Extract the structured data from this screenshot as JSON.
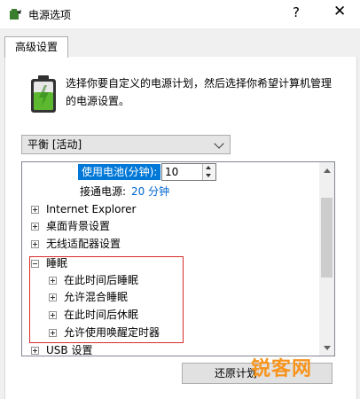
{
  "window": {
    "title": "电源选项",
    "help_label": "?",
    "close_label": "✕",
    "icon": "power-options-app-icon"
  },
  "tabs": [
    {
      "label": "高级设置",
      "active": true
    }
  ],
  "intro": {
    "icon": "battery-icon",
    "text": "选择你要自定义的电源计划，然后选择你希望计算机管理的电源设置。"
  },
  "plan_select": {
    "selected": "平衡 [活动]"
  },
  "settings_tree": {
    "selected_setting": {
      "label": "使用电池(分钟):",
      "value": "10"
    },
    "plugged_in": {
      "label": "接通电源:",
      "value": "20 分钟"
    },
    "items": [
      {
        "label": "Internet Explorer",
        "expanded": false,
        "level": 0
      },
      {
        "label": "桌面背景设置",
        "expanded": false,
        "level": 0
      },
      {
        "label": "无线适配器设置",
        "expanded": false,
        "level": 0
      },
      {
        "label": "睡眠",
        "expanded": true,
        "level": 0
      },
      {
        "label": "在此时间后睡眠",
        "expanded": false,
        "level": 1
      },
      {
        "label": "允许混合睡眠",
        "expanded": false,
        "level": 1
      },
      {
        "label": "在此时间后休眠",
        "expanded": false,
        "level": 1
      },
      {
        "label": "允许使用唤醒定时器",
        "expanded": false,
        "level": 1
      },
      {
        "label": "USB 设置",
        "expanded": false,
        "level": 0
      }
    ]
  },
  "buttons": {
    "restore_label": "还原计划"
  },
  "watermark": {
    "text": "锐客网"
  },
  "colors": {
    "highlight": "#0078d7",
    "annotation_box": "#d92e2e",
    "watermark": "#f7941d",
    "link_value": "#0066cc"
  }
}
